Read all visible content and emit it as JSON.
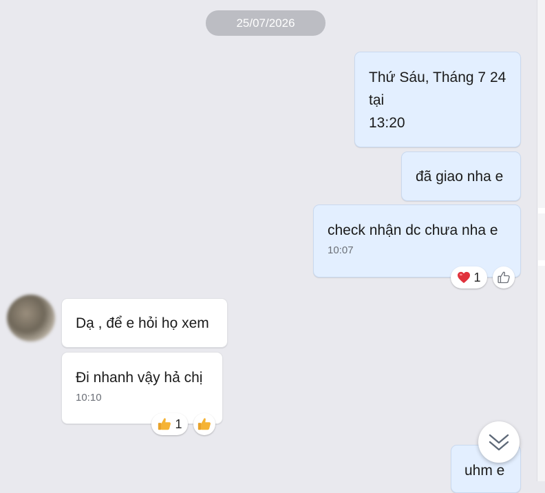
{
  "date_divider": "25/07/2026",
  "messages": {
    "m1": {
      "line1": "Thứ Sáu, Tháng 7 24",
      "line2": "tại",
      "line3": "13:20"
    },
    "m2": {
      "text": "đã giao nha e"
    },
    "m3": {
      "text": "check nhận dc chưa nha e",
      "time": "10:07",
      "reaction_count": "1"
    },
    "m4": {
      "text": "Dạ , để e hỏi họ xem"
    },
    "m5": {
      "text": "Đi nhanh vậy hả chị",
      "time": "10:10",
      "reaction_count": "1"
    },
    "m6": {
      "text": "uhm e"
    }
  },
  "icons": {
    "heart": "heart-icon",
    "thumbs_up_outline": "thumbs-up-outline-icon",
    "thumbs_up_emoji": "thumbs-up-emoji-icon",
    "scroll_down": "double-chevron-down-icon"
  },
  "colors": {
    "background": "#e9e9ee",
    "outgoing_bubble": "#e3efff",
    "incoming_bubble": "#ffffff",
    "date_pill": "#bcbdc3",
    "heart": "#e0323c",
    "thumb_emoji": "#f5b335"
  }
}
